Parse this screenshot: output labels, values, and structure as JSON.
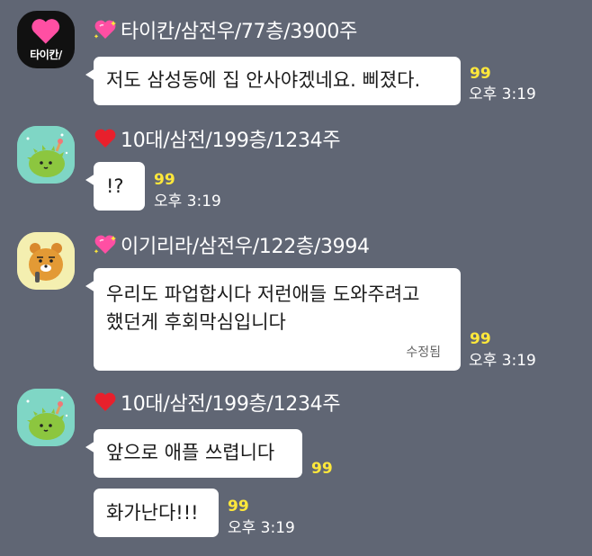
{
  "chat": {
    "groups": [
      {
        "sender": "타이칸/삼전우/77층/3900주",
        "avatar_label": "타이칸/",
        "avatar": "brand-logo",
        "heart": "sparkling-heart",
        "messages": [
          {
            "text": "저도 삼성동에 집 안사야겠네요. 삐졌다.",
            "unread": "99",
            "time": "오후 3:19"
          }
        ]
      },
      {
        "sender": "10대/삼전/199층/1234주",
        "avatar": "green-character",
        "heart": "red-heart",
        "messages": [
          {
            "text": "!?",
            "unread": "99",
            "time": "오후 3:19"
          }
        ]
      },
      {
        "sender": "이기리라/삼전우/122층/3994",
        "avatar": "ryan-bear-character",
        "heart": "sparkling-heart",
        "messages": [
          {
            "line1": "우리도 파업합시다 저런애들 도와주려고",
            "line2": "했던게 후회막심입니다",
            "edited": "수정됨",
            "unread": "99",
            "time": "오후 3:19"
          }
        ]
      },
      {
        "sender": "10대/삼전/199층/1234주",
        "avatar": "green-character",
        "heart": "red-heart",
        "messages": [
          {
            "text": "앞으로 애플 쓰렵니다",
            "unread": "99"
          },
          {
            "text": "화가난다!!!",
            "unread": "99",
            "time": "오후 3:19"
          }
        ]
      }
    ],
    "colors": {
      "background": "#606674",
      "bubble": "#ffffff",
      "unread": "#ffe83b",
      "heart_red": "#e8202c",
      "heart_pink": "#ff4fa3"
    }
  }
}
